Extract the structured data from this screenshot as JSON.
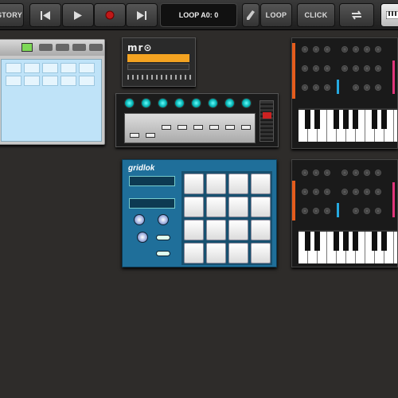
{
  "toolbar": {
    "history_label": "STORY",
    "loop_display": "LOOP A0: 0",
    "loop_label": "LOOP",
    "click_label": "CLICK"
  },
  "modules": {
    "mro_logo": "mr⊙",
    "gridlok_title": "gridlok"
  },
  "colors": {
    "background": "#2e2c2a",
    "record_red": "#c01818",
    "mixer_knob": "#19c4c4",
    "gridlok_blue": "#1f6f9a",
    "synth_orange": "#e55c1c",
    "synth_blue": "#25a9e0",
    "mro_orange": "#f4a321"
  },
  "icons": [
    "skip-back-icon",
    "play-icon",
    "record-icon",
    "skip-forward-icon",
    "pencil-icon",
    "repeat-icon",
    "keyboard-icon"
  ]
}
